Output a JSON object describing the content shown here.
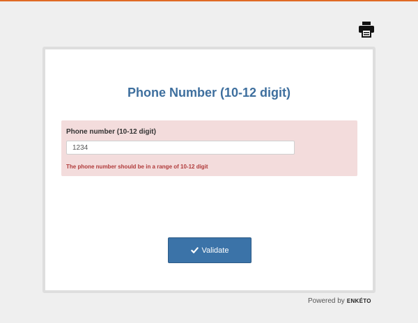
{
  "colors": {
    "accent_bar": "#e06a24",
    "title": "#3e6f9e",
    "error_bg": "#f3dcdc",
    "error_text": "#b03a3a",
    "button_bg": "#3b73a8"
  },
  "toolbar": {
    "print_icon": "print-icon"
  },
  "form": {
    "title": "Phone Number (10-12 digit)"
  },
  "question": {
    "label": "Phone number (10-12 digit)",
    "value": "1234",
    "error": "The phone number should be in a range of 10-12 digit"
  },
  "actions": {
    "validate_label": "Validate",
    "validate_icon": "check-icon"
  },
  "footer": {
    "powered_by": "Powered by",
    "brand": "ENKÉTO"
  }
}
